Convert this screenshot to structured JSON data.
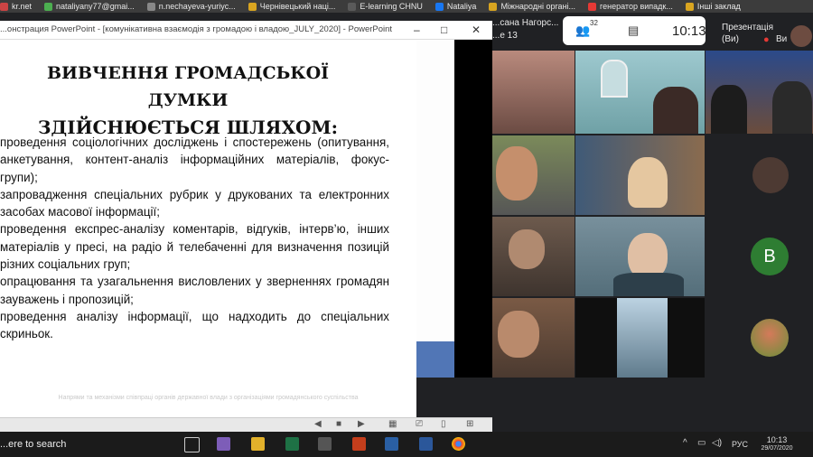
{
  "bookmarks": [
    {
      "label": "kr.net",
      "color": "#cc4444"
    },
    {
      "label": "nataliyany77@gmai...",
      "color": "#4caf50"
    },
    {
      "label": "n.nechayeva-yuriyc...",
      "color": "#888888"
    },
    {
      "label": "Чернівецький наці...",
      "color": "#d9a520"
    },
    {
      "label": "E-learning CHNU",
      "color": "#5a5a5a"
    },
    {
      "label": "Nataliya",
      "color": "#1877f2"
    },
    {
      "label": "Міжнародні органі...",
      "color": "#d9a520"
    },
    {
      "label": "генератор випадк...",
      "color": "#e53935"
    },
    {
      "label": "Інші заклад",
      "color": "#d9a520"
    }
  ],
  "ppt": {
    "title": "...онстрация PowerPoint - [комунікативна взаємодія з громадою і владою_JULY_2020] - PowerPoint",
    "minimize": "–",
    "maximize": "□",
    "close": "✕"
  },
  "slide": {
    "heading_line1": "ВИВЧЕННЯ ГРОМАДСЬКОЇ ДУМКИ",
    "heading_line2": "ЗДІЙСНЮЄТЬСЯ ШЛЯХОМ:",
    "bullets": [
      "проведення соціологічних досліджень і спостережень (опитування, анкетування, контент-аналіз інформаційних матеріалів, фокус-групи);",
      "запровадження спеціальних рубрик у друкованих та електронних засобах масової інформації;",
      "проведення експрес-аналізу коментарів, відгуків, інтерв’ю, інших матеріалів у пресі, на радіо й телебаченні для визначення позицій різних соціальних груп;",
      "опрацювання та узагальнення висловлених у зверненнях громадян зауважень і пропозицій;",
      "проведення аналізу інформації, що надходить до спеціальних скриньок."
    ],
    "footer": "Напрями та механізми співпраці органів державної влади з організаціями громадянського суспільства"
  },
  "ppt_controls": [
    "◀",
    "■",
    "▶",
    "▦",
    "⎚",
    "▯",
    "⊞",
    "⊟"
  ],
  "meet": {
    "presenter_name": "...сана Нагорс...",
    "presenter_sub": "...е 13",
    "participants_count": "32",
    "time": "10:13",
    "presentation_label": "Презентація",
    "presentation_sub": "(Ви)",
    "you_label": "Ви",
    "avatar_letter": "B",
    "avatar_color": "#2e7d32"
  },
  "taskbar": {
    "search": "...ere to search",
    "lang": "РУС",
    "clock_time": "10:13",
    "clock_date": "29/07/2020"
  }
}
